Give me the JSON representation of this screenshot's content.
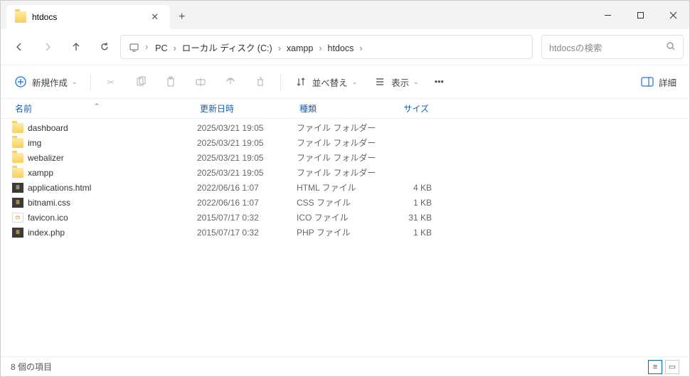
{
  "tab": {
    "title": "htdocs"
  },
  "breadcrumbs": [
    "PC",
    "ローカル ディスク (C:)",
    "xampp",
    "htdocs"
  ],
  "search": {
    "placeholder": "htdocsの検索"
  },
  "toolbar": {
    "new": "新規作成",
    "sort": "並べ替え",
    "view": "表示",
    "details": "詳細"
  },
  "columns": {
    "name": "名前",
    "date": "更新日時",
    "type": "種類",
    "size": "サイズ"
  },
  "items": [
    {
      "icon": "folder",
      "name": "dashboard",
      "date": "2025/03/21 19:05",
      "type": "ファイル フォルダー",
      "size": ""
    },
    {
      "icon": "folder",
      "name": "img",
      "date": "2025/03/21 19:05",
      "type": "ファイル フォルダー",
      "size": ""
    },
    {
      "icon": "folder",
      "name": "webalizer",
      "date": "2025/03/21 19:05",
      "type": "ファイル フォルダー",
      "size": ""
    },
    {
      "icon": "folder",
      "name": "xampp",
      "date": "2025/03/21 19:05",
      "type": "ファイル フォルダー",
      "size": ""
    },
    {
      "icon": "code",
      "name": "applications.html",
      "date": "2022/06/16 1:07",
      "type": "HTML ファイル",
      "size": "4 KB"
    },
    {
      "icon": "code",
      "name": "bitnami.css",
      "date": "2022/06/16 1:07",
      "type": "CSS ファイル",
      "size": "1 KB"
    },
    {
      "icon": "ico",
      "name": "favicon.ico",
      "date": "2015/07/17 0:32",
      "type": "ICO ファイル",
      "size": "31 KB"
    },
    {
      "icon": "code",
      "name": "index.php",
      "date": "2015/07/17 0:32",
      "type": "PHP ファイル",
      "size": "1 KB"
    }
  ],
  "status": "8 個の項目"
}
